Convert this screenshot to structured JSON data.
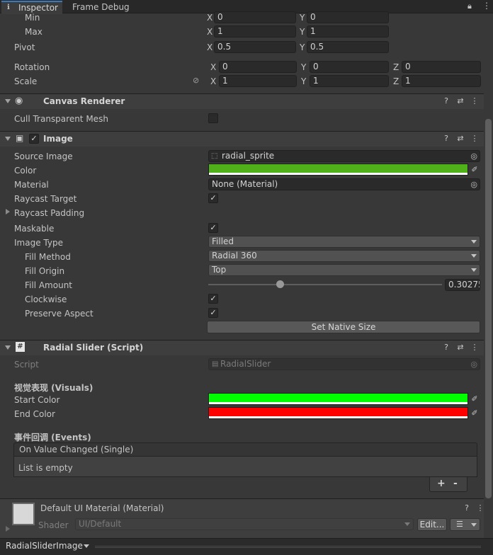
{
  "tabs": [
    {
      "label": "Inspector",
      "icon": "info-icon"
    },
    {
      "label": "Frame Debug"
    }
  ],
  "rect_transform": {
    "min": {
      "label": "Min",
      "x": "0",
      "y": "0"
    },
    "max": {
      "label": "Max",
      "x": "1",
      "y": "1"
    },
    "pivot": {
      "label": "Pivot",
      "x": "0.5",
      "y": "0.5"
    },
    "rotation": {
      "label": "Rotation",
      "x": "0",
      "y": "0",
      "z": "0"
    },
    "scale": {
      "label": "Scale",
      "x": "1",
      "y": "1",
      "z": "1"
    },
    "axis_x": "X",
    "axis_y": "Y",
    "axis_z": "Z"
  },
  "canvas_renderer": {
    "title": "Canvas Renderer",
    "cull_label": "Cull Transparent Mesh",
    "cull_checked": false
  },
  "image": {
    "title": "Image",
    "enabled": true,
    "source_image_label": "Source Image",
    "source_image_value": "radial_sprite",
    "color_label": "Color",
    "color_value": "#4fb01a",
    "material_label": "Material",
    "material_value": "None (Material)",
    "raycast_target_label": "Raycast Target",
    "raycast_target": true,
    "raycast_padding_label": "Raycast Padding",
    "maskable_label": "Maskable",
    "maskable": true,
    "image_type_label": "Image Type",
    "image_type_value": "Filled",
    "fill_method_label": "Fill Method",
    "fill_method_value": "Radial 360",
    "fill_origin_label": "Fill Origin",
    "fill_origin_value": "Top",
    "fill_amount_label": "Fill Amount",
    "fill_amount_value": "0.30275",
    "clockwise_label": "Clockwise",
    "clockwise": true,
    "preserve_aspect_label": "Preserve Aspect",
    "preserve_aspect": true,
    "set_native_size_label": "Set Native Size"
  },
  "radial_slider": {
    "title": "Radial Slider (Script)",
    "script_label": "Script",
    "script_value": "RadialSlider",
    "visuals_header": "视觉表现 (Visuals)",
    "start_color_label": "Start Color",
    "start_color_value": "#00ff00",
    "end_color_label": "End Color",
    "end_color_value": "#ff0000",
    "events_header": "事件回调 (Events)",
    "event_name": "On Value Changed (Single)",
    "event_empty": "List is empty",
    "add_label": "+",
    "remove_label": "-"
  },
  "material_preview": {
    "title": "Default UI Material (Material)",
    "shader_label": "Shader",
    "shader_value": "UI/Default",
    "edit_label": "Edit..."
  },
  "footer": {
    "object_name": "RadialSliderImage"
  },
  "colors": {
    "background": "#383838",
    "header": "#3e3e3e",
    "field": "#2a2a2a"
  }
}
